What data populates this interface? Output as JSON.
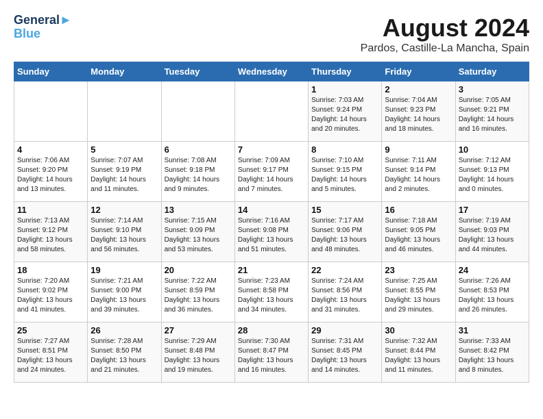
{
  "header": {
    "logo_line1": "General",
    "logo_line2": "Blue",
    "month": "August 2024",
    "location": "Pardos, Castille-La Mancha, Spain"
  },
  "weekdays": [
    "Sunday",
    "Monday",
    "Tuesday",
    "Wednesday",
    "Thursday",
    "Friday",
    "Saturday"
  ],
  "weeks": [
    [
      {
        "day": "",
        "info": ""
      },
      {
        "day": "",
        "info": ""
      },
      {
        "day": "",
        "info": ""
      },
      {
        "day": "",
        "info": ""
      },
      {
        "day": "1",
        "info": "Sunrise: 7:03 AM\nSunset: 9:24 PM\nDaylight: 14 hours\nand 20 minutes."
      },
      {
        "day": "2",
        "info": "Sunrise: 7:04 AM\nSunset: 9:23 PM\nDaylight: 14 hours\nand 18 minutes."
      },
      {
        "day": "3",
        "info": "Sunrise: 7:05 AM\nSunset: 9:21 PM\nDaylight: 14 hours\nand 16 minutes."
      }
    ],
    [
      {
        "day": "4",
        "info": "Sunrise: 7:06 AM\nSunset: 9:20 PM\nDaylight: 14 hours\nand 13 minutes."
      },
      {
        "day": "5",
        "info": "Sunrise: 7:07 AM\nSunset: 9:19 PM\nDaylight: 14 hours\nand 11 minutes."
      },
      {
        "day": "6",
        "info": "Sunrise: 7:08 AM\nSunset: 9:18 PM\nDaylight: 14 hours\nand 9 minutes."
      },
      {
        "day": "7",
        "info": "Sunrise: 7:09 AM\nSunset: 9:17 PM\nDaylight: 14 hours\nand 7 minutes."
      },
      {
        "day": "8",
        "info": "Sunrise: 7:10 AM\nSunset: 9:15 PM\nDaylight: 14 hours\nand 5 minutes."
      },
      {
        "day": "9",
        "info": "Sunrise: 7:11 AM\nSunset: 9:14 PM\nDaylight: 14 hours\nand 2 minutes."
      },
      {
        "day": "10",
        "info": "Sunrise: 7:12 AM\nSunset: 9:13 PM\nDaylight: 14 hours\nand 0 minutes."
      }
    ],
    [
      {
        "day": "11",
        "info": "Sunrise: 7:13 AM\nSunset: 9:12 PM\nDaylight: 13 hours\nand 58 minutes."
      },
      {
        "day": "12",
        "info": "Sunrise: 7:14 AM\nSunset: 9:10 PM\nDaylight: 13 hours\nand 56 minutes."
      },
      {
        "day": "13",
        "info": "Sunrise: 7:15 AM\nSunset: 9:09 PM\nDaylight: 13 hours\nand 53 minutes."
      },
      {
        "day": "14",
        "info": "Sunrise: 7:16 AM\nSunset: 9:08 PM\nDaylight: 13 hours\nand 51 minutes."
      },
      {
        "day": "15",
        "info": "Sunrise: 7:17 AM\nSunset: 9:06 PM\nDaylight: 13 hours\nand 48 minutes."
      },
      {
        "day": "16",
        "info": "Sunrise: 7:18 AM\nSunset: 9:05 PM\nDaylight: 13 hours\nand 46 minutes."
      },
      {
        "day": "17",
        "info": "Sunrise: 7:19 AM\nSunset: 9:03 PM\nDaylight: 13 hours\nand 44 minutes."
      }
    ],
    [
      {
        "day": "18",
        "info": "Sunrise: 7:20 AM\nSunset: 9:02 PM\nDaylight: 13 hours\nand 41 minutes."
      },
      {
        "day": "19",
        "info": "Sunrise: 7:21 AM\nSunset: 9:00 PM\nDaylight: 13 hours\nand 39 minutes."
      },
      {
        "day": "20",
        "info": "Sunrise: 7:22 AM\nSunset: 8:59 PM\nDaylight: 13 hours\nand 36 minutes."
      },
      {
        "day": "21",
        "info": "Sunrise: 7:23 AM\nSunset: 8:58 PM\nDaylight: 13 hours\nand 34 minutes."
      },
      {
        "day": "22",
        "info": "Sunrise: 7:24 AM\nSunset: 8:56 PM\nDaylight: 13 hours\nand 31 minutes."
      },
      {
        "day": "23",
        "info": "Sunrise: 7:25 AM\nSunset: 8:55 PM\nDaylight: 13 hours\nand 29 minutes."
      },
      {
        "day": "24",
        "info": "Sunrise: 7:26 AM\nSunset: 8:53 PM\nDaylight: 13 hours\nand 26 minutes."
      }
    ],
    [
      {
        "day": "25",
        "info": "Sunrise: 7:27 AM\nSunset: 8:51 PM\nDaylight: 13 hours\nand 24 minutes."
      },
      {
        "day": "26",
        "info": "Sunrise: 7:28 AM\nSunset: 8:50 PM\nDaylight: 13 hours\nand 21 minutes."
      },
      {
        "day": "27",
        "info": "Sunrise: 7:29 AM\nSunset: 8:48 PM\nDaylight: 13 hours\nand 19 minutes."
      },
      {
        "day": "28",
        "info": "Sunrise: 7:30 AM\nSunset: 8:47 PM\nDaylight: 13 hours\nand 16 minutes."
      },
      {
        "day": "29",
        "info": "Sunrise: 7:31 AM\nSunset: 8:45 PM\nDaylight: 13 hours\nand 14 minutes."
      },
      {
        "day": "30",
        "info": "Sunrise: 7:32 AM\nSunset: 8:44 PM\nDaylight: 13 hours\nand 11 minutes."
      },
      {
        "day": "31",
        "info": "Sunrise: 7:33 AM\nSunset: 8:42 PM\nDaylight: 13 hours\nand 8 minutes."
      }
    ]
  ]
}
